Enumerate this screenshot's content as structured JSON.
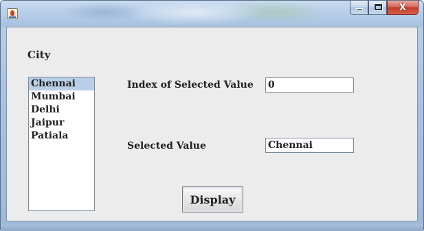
{
  "window": {
    "title": "",
    "controls": {
      "close_label": "X"
    }
  },
  "form": {
    "city_label": "City",
    "cities": [
      "Chennai",
      "Mumbai",
      "Delhi",
      "Jaipur",
      "Patiala"
    ],
    "selected_city_index": 0,
    "index_label": "Index of Selected Value",
    "index_value": "0",
    "selected_value_label": "Selected Value",
    "selected_value": "Chennai",
    "display_button_label": "Display"
  },
  "colors": {
    "selection": "#b8cfe5",
    "panel": "#ececec",
    "titlebar": "#b5cde8",
    "close_button": "#c43b2a"
  },
  "icons": {
    "app": "java-cup-icon",
    "minimize": "minimize-icon",
    "maximize": "maximize-icon",
    "close": "close-icon"
  }
}
